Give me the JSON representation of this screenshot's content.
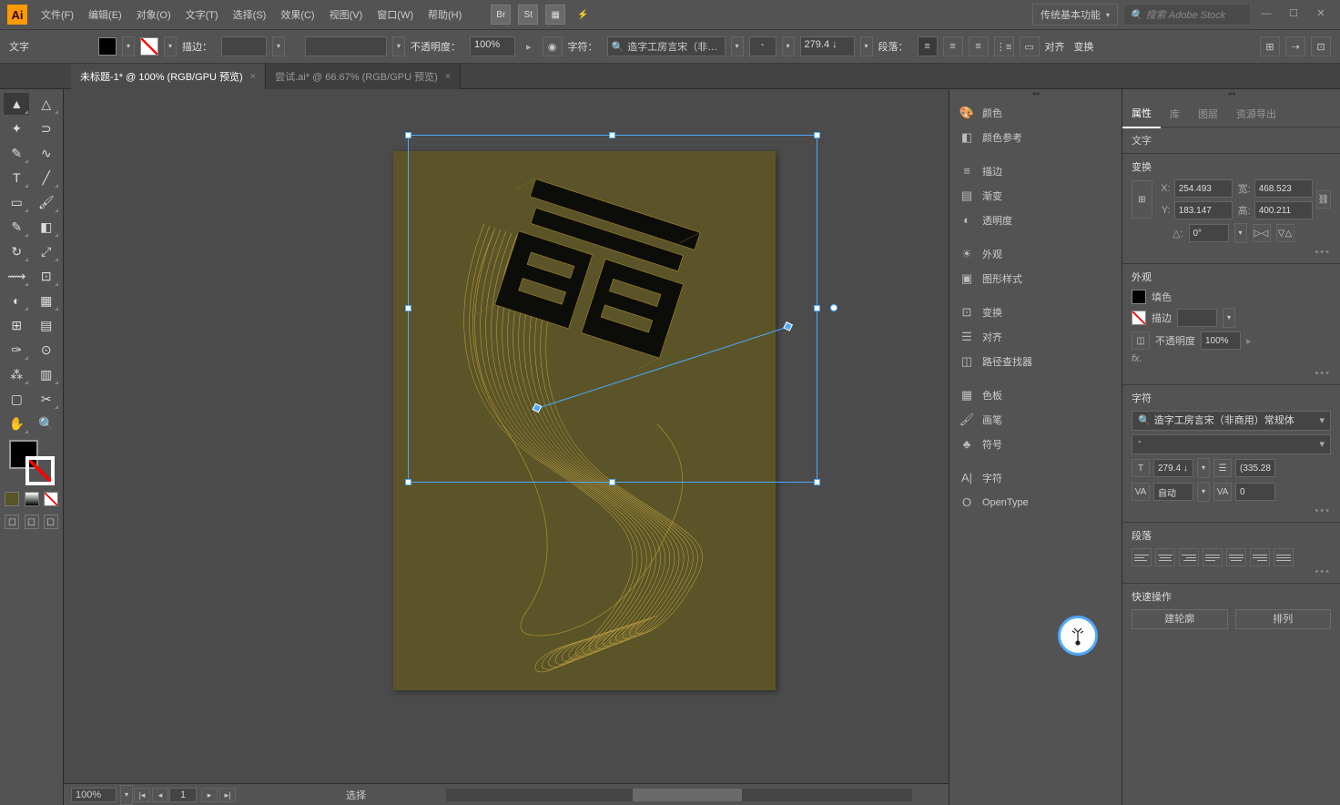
{
  "app_logo": "Ai",
  "menu": [
    "文件(F)",
    "编辑(E)",
    "对象(O)",
    "文字(T)",
    "选择(S)",
    "效果(C)",
    "视图(V)",
    "窗口(W)",
    "帮助(H)"
  ],
  "top_icons": [
    "Br",
    "St"
  ],
  "workspace": "传统基本功能",
  "search_placeholder": "搜索 Adobe Stock",
  "ctrl": {
    "tool_label": "文字",
    "stroke_label": "描边：",
    "stroke_weight": "",
    "opacity_label": "不透明度：",
    "opacity_value": "100%",
    "char_label": "字符：",
    "font_name": "造字工房言宋（非…",
    "font_style": "-",
    "font_size": "279.4 ↓",
    "para_label": "段落：",
    "align_label": "对齐",
    "transform_label": "变换"
  },
  "tabs": [
    {
      "label": "未标题-1* @ 100% (RGB/GPU 预览)",
      "active": true
    },
    {
      "label": "尝试.ai* @ 66.67% (RGB/GPU 预览)",
      "active": false
    }
  ],
  "mid_panels": [
    "颜色",
    "颜色参考",
    "描边",
    "渐变",
    "透明度",
    "外观",
    "图形样式",
    "变换",
    "对齐",
    "路径查找器",
    "色板",
    "画笔",
    "符号",
    "字符",
    "OpenType"
  ],
  "right": {
    "tabs": [
      "属性",
      "库",
      "图层",
      "资源导出"
    ],
    "obj_type": "文字",
    "transform": {
      "title": "变换",
      "x_lbl": "X:",
      "x": "254.493",
      "y_lbl": "Y:",
      "y": "183.147",
      "w_lbl": "宽:",
      "w": "468.523",
      "h_lbl": "高:",
      "h": "400.211",
      "angle_lbl": "△:",
      "angle": "0°"
    },
    "appearance": {
      "title": "外观",
      "fill": "填色",
      "stroke": "描边",
      "opacity_lbl": "不透明度",
      "opacity": "100%",
      "fx": "fx."
    },
    "char": {
      "title": "字符",
      "font": "造字工房言宋（非商用）常规体",
      "style": "-",
      "size": "279.4 ↓",
      "leading": "(335.28",
      "kern": "自动",
      "tracking": "0"
    },
    "para": {
      "title": "段落"
    },
    "quick": {
      "title": "快速操作",
      "btn1": "建轮廓",
      "btn2": "排列"
    }
  },
  "status": {
    "zoom": "100%",
    "page": "1",
    "tool": "选择"
  }
}
